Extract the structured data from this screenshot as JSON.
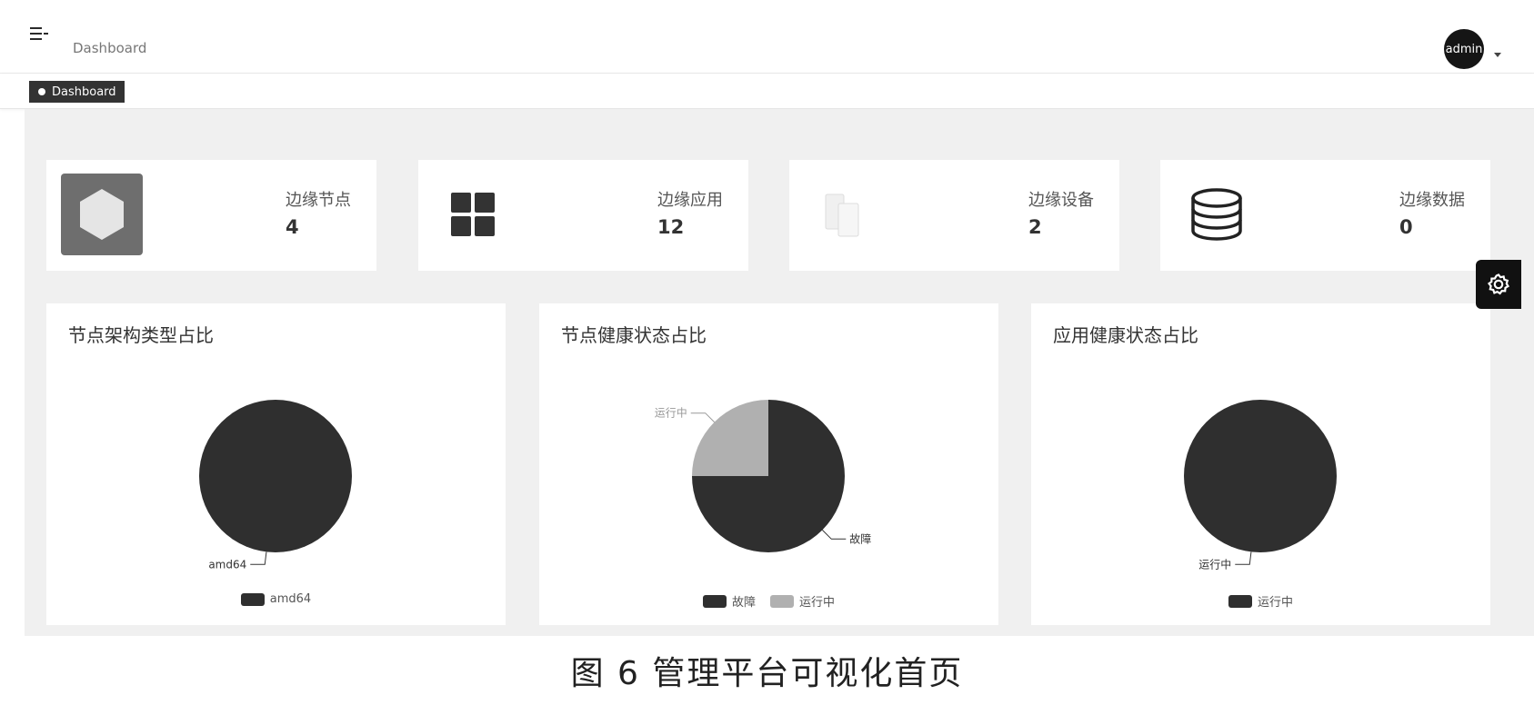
{
  "navbar": {
    "breadcrumb": "Dashboard",
    "avatar_text": "admin"
  },
  "tags": [
    {
      "label": "Dashboard",
      "active": true
    }
  ],
  "stat_cards": [
    {
      "label": "边缘节点",
      "value": "4",
      "icon": "hexagon-icon"
    },
    {
      "label": "边缘应用",
      "value": "12",
      "icon": "grid-icon"
    },
    {
      "label": "边缘设备",
      "value": "2",
      "icon": "devices-icon"
    },
    {
      "label": "边缘数据",
      "value": "0",
      "icon": "database-icon"
    }
  ],
  "colors": {
    "dark": "#2f2f2f",
    "light": "#b0b0b0",
    "page_bg": "#f0f0f0"
  },
  "chart_data": [
    {
      "type": "pie",
      "title": "节点架构类型占比",
      "slices": [
        {
          "name": "amd64",
          "value": 1
        }
      ],
      "legend": [
        "amd64"
      ]
    },
    {
      "type": "pie",
      "title": "节点健康状态占比",
      "slices": [
        {
          "name": "故障",
          "value": 3
        },
        {
          "name": "运行中",
          "value": 1
        }
      ],
      "legend": [
        "故障",
        "运行中"
      ]
    },
    {
      "type": "pie",
      "title": "应用健康状态占比",
      "slices": [
        {
          "name": "运行中",
          "value": 1
        }
      ],
      "legend": [
        "运行中"
      ]
    }
  ],
  "caption": "图 6   管理平台可视化首页"
}
